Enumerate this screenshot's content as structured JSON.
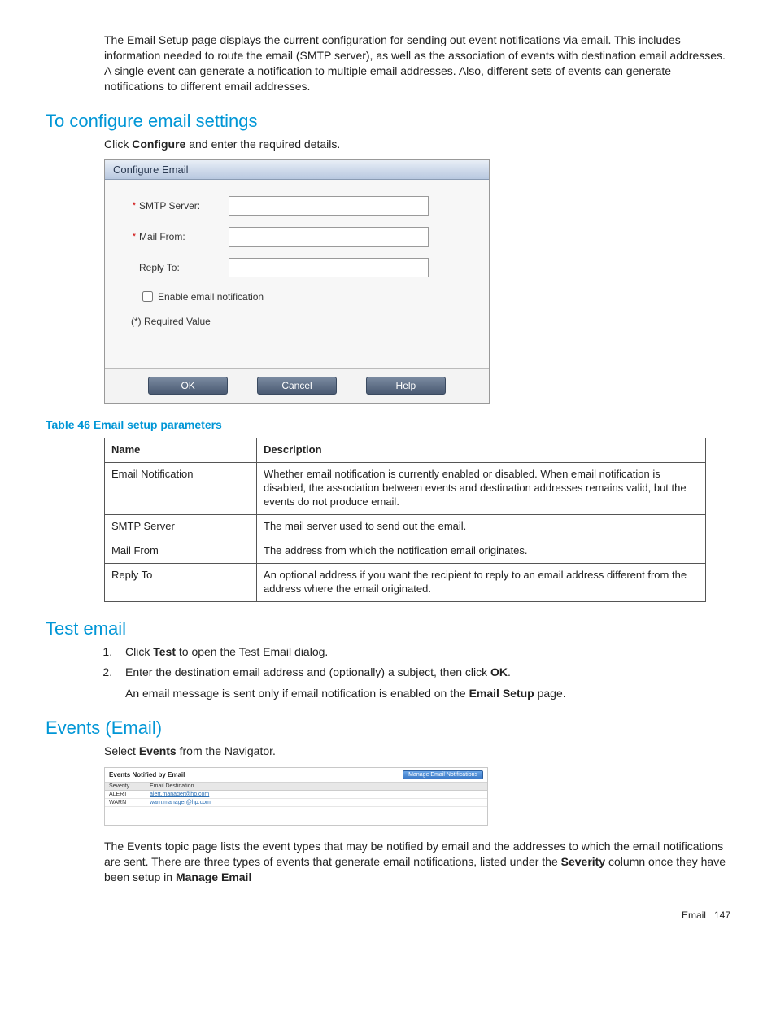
{
  "intro": "The Email Setup page displays the current configuration for sending out event notifications via email. This includes information needed to route the email (SMTP server), as well as the association of events with destination email addresses. A single event can generate a notification to multiple email addresses. Also, different sets of events can generate notifications to different email addresses.",
  "configure": {
    "heading": "To configure email settings",
    "instruction_prefix": "Click ",
    "instruction_bold": "Configure",
    "instruction_suffix": " and enter the required details.",
    "panel_title": "Configure Email",
    "smtp_label": "SMTP Server:",
    "mailfrom_label": "Mail From:",
    "replyto_label": "Reply To:",
    "enable_label": "Enable email notification",
    "required_note": "(*) Required Value",
    "ok": "OK",
    "cancel": "Cancel",
    "help": "Help"
  },
  "table46": {
    "caption": "Table 46 Email setup parameters",
    "col_name": "Name",
    "col_desc": "Description",
    "rows": [
      {
        "name": "Email Notification",
        "desc": "Whether email notification is currently enabled or disabled. When email notification is disabled, the association between events and destination addresses remains valid, but the events do not produce email."
      },
      {
        "name": "SMTP Server",
        "desc": "The mail server used to send out the email."
      },
      {
        "name": "Mail From",
        "desc": "The address from which the notification email originates."
      },
      {
        "name": "Reply To",
        "desc": "An optional address if you want the recipient to reply to an email address different from the address where the email originated."
      }
    ]
  },
  "test": {
    "heading": "Test email",
    "step1_prefix": "Click ",
    "step1_bold": "Test",
    "step1_suffix": " to open the Test Email dialog.",
    "step2_prefix": "Enter the destination email address and (optionally) a subject, then click ",
    "step2_bold": "OK",
    "step2_suffix": ".",
    "step2_extra_prefix": "An email message is sent only if email notification is enabled on the ",
    "step2_extra_bold": "Email Setup",
    "step2_extra_suffix": " page."
  },
  "events": {
    "heading": "Events (Email)",
    "select_prefix": "Select ",
    "select_bold": "Events",
    "select_suffix": " from the Navigator.",
    "box_title": "Events Notified by Email",
    "manage_btn": "Manage Email Notifications",
    "col_sev": "Severity",
    "col_dest": "Email Destination",
    "rows": [
      {
        "sev": "ALERT",
        "dest": "alert.manager@hp.com"
      },
      {
        "sev": "WARN",
        "dest": "warn.manager@hp.com"
      }
    ],
    "para_prefix": "The Events topic page lists the event types that may be notified by email and the addresses to which the email notifications are sent. There are three types of events that generate email notifications, listed under the ",
    "para_bold1": "Severity",
    "para_mid": " column once they have been setup in ",
    "para_bold2": "Manage Email"
  },
  "footer": {
    "section": "Email",
    "page": "147"
  }
}
